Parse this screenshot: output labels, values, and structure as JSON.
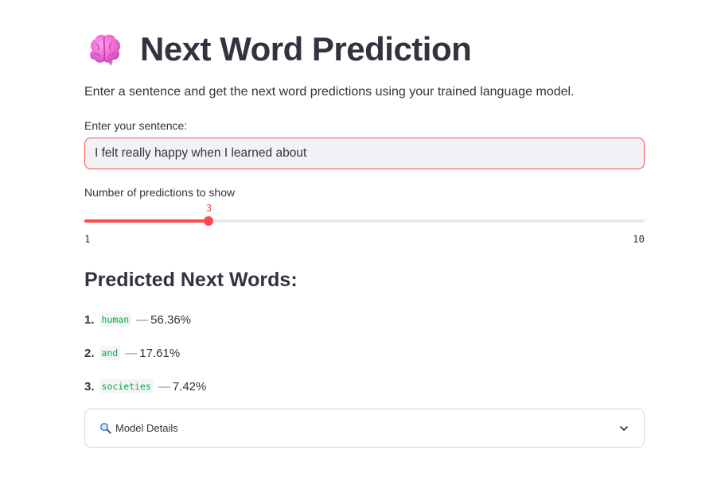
{
  "header": {
    "icon": "brain-icon",
    "title": "Next Word Prediction",
    "subtitle": "Enter a sentence and get the next word predictions using your trained language model."
  },
  "sentence_input": {
    "label": "Enter your sentence:",
    "value": "I felt really happy when I learned about"
  },
  "slider": {
    "label": "Number of predictions to show",
    "value": "3",
    "min": "1",
    "max": "10",
    "value_number": 3,
    "min_number": 1,
    "max_number": 10
  },
  "predictions": {
    "heading": "Predicted Next Words:",
    "items": [
      {
        "rank": "1.",
        "word": "human",
        "dash": "—",
        "percent": "56.36%"
      },
      {
        "rank": "2.",
        "word": "and",
        "dash": "—",
        "percent": "17.61%"
      },
      {
        "rank": "3.",
        "word": "societies",
        "dash": "—",
        "percent": "7.42%"
      }
    ]
  },
  "expander": {
    "icon": "magnifier-icon",
    "label": "Model Details",
    "toggle_icon": "chevron-down-icon"
  },
  "colors": {
    "accent": "#ff4b4b",
    "text": "#31333f",
    "code_text": "#09ab3b",
    "input_bg": "#f0f2f6"
  }
}
